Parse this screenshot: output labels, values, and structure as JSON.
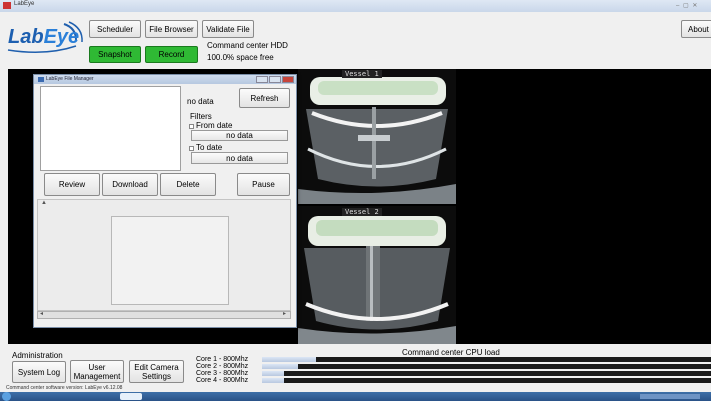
{
  "window": {
    "title": "LabEye",
    "controls": "– ▢ ✕"
  },
  "logo": {
    "text_lab": "Lab",
    "text_eye": "Eye"
  },
  "toolbar": {
    "scheduler_label": "Scheduler",
    "file_browser_label": "File Browser",
    "validate_file_label": "Validate File",
    "about_label": "About",
    "snapshot_label": "Snapshot",
    "record_label": "Record",
    "command_center_label": "Command center HDD",
    "space_free": "100.0% space free"
  },
  "cameras": [
    {
      "label": "Vessel 1"
    },
    {
      "label": "Vessel 2"
    }
  ],
  "file_manager": {
    "title": "LabEye File Manager",
    "status": "no data",
    "refresh_label": "Refresh",
    "filters_label": "Filters",
    "from_date_label": "From date",
    "from_date_value": "no data",
    "to_date_label": "To date",
    "to_date_value": "no data",
    "review_label": "Review",
    "download_label": "Download",
    "delete_label": "Delete",
    "pause_label": "Pause"
  },
  "administration": {
    "title": "Administration",
    "system_log_label": "System Log",
    "user_management_label": "User\nManagement",
    "edit_camera_label": "Edit Camera\nSettings"
  },
  "cpu": {
    "title": "Command center CPU load",
    "cores": [
      {
        "label": "Core 1 - 800Mhz",
        "load": 0.12
      },
      {
        "label": "Core 2 - 800Mhz",
        "load": 0.08
      },
      {
        "label": "Core 3 - 800Mhz",
        "load": 0.05
      },
      {
        "label": "Core 4 - 800Mhz",
        "load": 0.05
      }
    ]
  },
  "status_bar": {
    "version": "Command center software version: LabEye v6.12.08"
  }
}
